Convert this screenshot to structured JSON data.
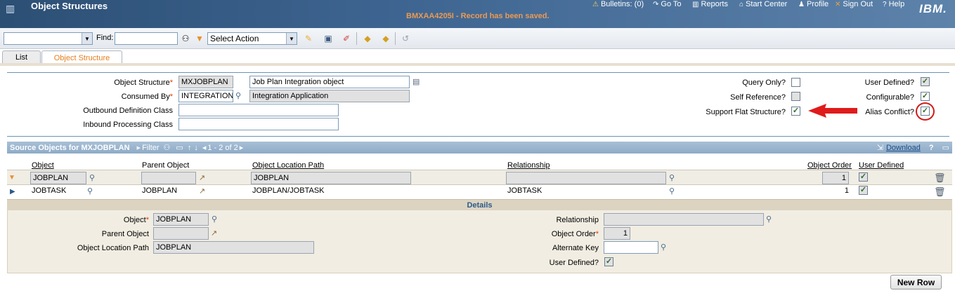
{
  "header": {
    "app_title": "Object Structures",
    "status_message": "BMXAA4205I - Record has been saved.",
    "nav": {
      "bulletins": "Bulletins: (0)",
      "goto": "Go To",
      "reports": "Reports",
      "start_center": "Start Center",
      "profile": "Profile",
      "sign_out": "Sign Out",
      "help": "Help"
    },
    "brand": "IBM."
  },
  "toolbar": {
    "find_label": "Find:",
    "find_value": "",
    "select_action": "Select Action"
  },
  "tabs": [
    {
      "label": "List"
    },
    {
      "label": "Object Structure"
    }
  ],
  "form": {
    "object_structure": {
      "label": "Object Structure",
      "value": "MXJOBPLAN",
      "description": "Job Plan Integration object"
    },
    "consumed_by": {
      "label": "Consumed By",
      "value": "INTEGRATION",
      "description": "Integration Application"
    },
    "outbound_definition_class": {
      "label": "Outbound Definition Class",
      "value": ""
    },
    "inbound_processing_class": {
      "label": "Inbound Processing Class",
      "value": ""
    },
    "query_only": {
      "label": "Query Only?",
      "checked": false
    },
    "self_reference": {
      "label": "Self Reference?",
      "checked": false
    },
    "support_flat_structure": {
      "label": "Support Flat Structure?",
      "checked": true
    },
    "user_defined": {
      "label": "User Defined?",
      "checked": true
    },
    "configurable": {
      "label": "Configurable?",
      "checked": true
    },
    "alias_conflict": {
      "label": "Alias Conflict?",
      "checked": true
    }
  },
  "source_objects": {
    "title": "Source Objects for MXJOBPLAN",
    "filter_label": "Filter",
    "pagination": "1 - 2 of 2",
    "download_label": "Download",
    "help_label": "?",
    "columns": {
      "object": "Object",
      "parent_object": "Parent Object",
      "object_location_path": "Object Location Path",
      "relationship": "Relationship",
      "object_order": "Object Order",
      "user_defined": "User Defined"
    },
    "rows": [
      {
        "object": "JOBPLAN",
        "parent_object": "",
        "path": "JOBPLAN",
        "relationship": "",
        "order": "1",
        "user_defined": true
      },
      {
        "object": "JOBTASK",
        "parent_object": "JOBPLAN",
        "path": "JOBPLAN/JOBTASK",
        "relationship": "JOBTASK",
        "order": "1",
        "user_defined": true
      }
    ]
  },
  "details": {
    "title": "Details",
    "object": {
      "label": "Object",
      "value": "JOBPLAN"
    },
    "parent_object": {
      "label": "Parent Object",
      "value": ""
    },
    "object_location_path": {
      "label": "Object Location Path",
      "value": "JOBPLAN"
    },
    "relationship": {
      "label": "Relationship",
      "value": ""
    },
    "object_order": {
      "label": "Object Order",
      "value": "1"
    },
    "alternate_key": {
      "label": "Alternate Key",
      "value": ""
    },
    "user_defined": {
      "label": "User Defined?",
      "checked": true
    }
  },
  "new_row_label": "New Row",
  "annotation_color": "#e01b1b"
}
